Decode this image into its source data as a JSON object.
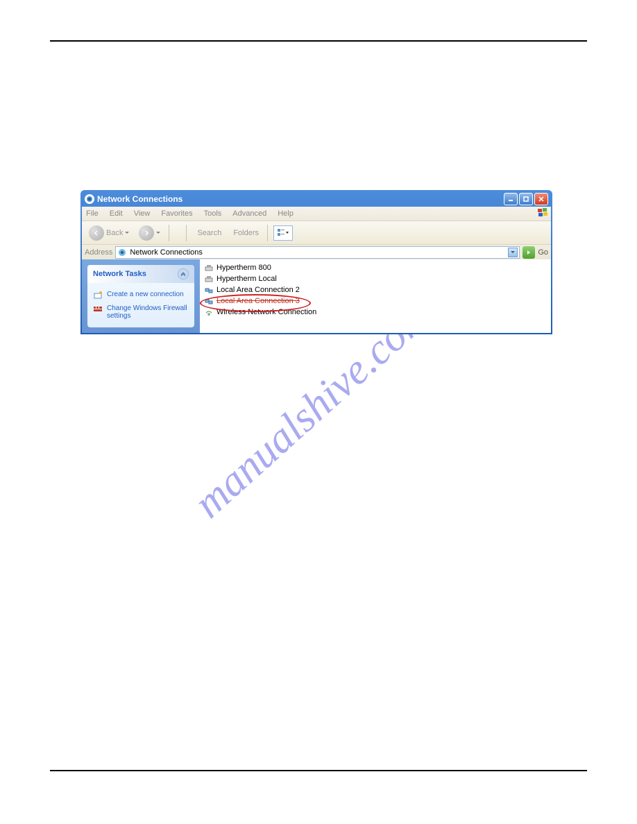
{
  "window": {
    "title": "Network Connections"
  },
  "menu": {
    "items": [
      "File",
      "Edit",
      "View",
      "Favorites",
      "Tools",
      "Advanced",
      "Help"
    ]
  },
  "toolbar": {
    "back": "Back",
    "search": "Search",
    "folders": "Folders"
  },
  "addressbar": {
    "label": "Address",
    "value": "Network Connections",
    "go": "Go"
  },
  "sidebar": {
    "panel_title": "Network Tasks",
    "links": [
      "Create a new connection",
      "Change Windows Firewall settings"
    ]
  },
  "connections": [
    "Hypertherm 800",
    "Hypertherm Local",
    "Local Area Connection 2",
    "Local Area Connection 3",
    "Wireless Network Connection"
  ],
  "watermark": "manualshive.com"
}
